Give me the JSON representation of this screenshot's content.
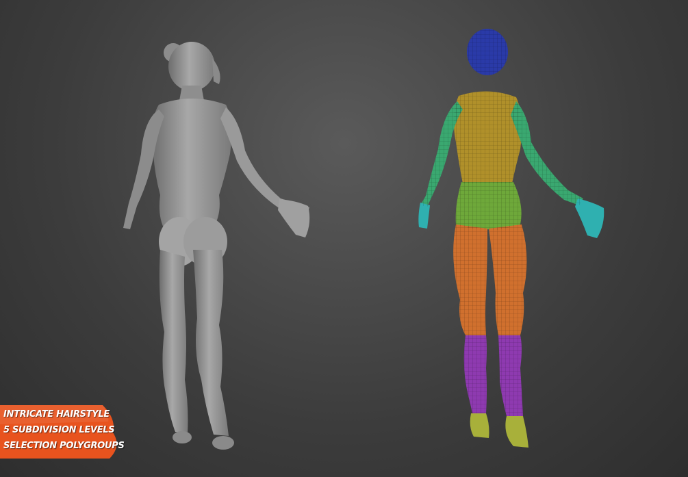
{
  "badge": {
    "lines": [
      "INTRICATE HAIRSTYLE",
      "5 SUBDIVISION LEVELS",
      "SELECTION POLYGROUPS"
    ],
    "color": "#e8531e"
  },
  "figures": {
    "left": {
      "style": "sculpt",
      "color": "#9a9a9a"
    },
    "right": {
      "style": "polygroups",
      "group_colors": {
        "head": "#2a3aa8",
        "torso": "#b0902a",
        "arms": "#3aa870",
        "hands": "#2fb0b0",
        "hips": "#6ea83a",
        "legs": "#d0702e",
        "shins": "#8e3ab0",
        "feet": "#a8b03a"
      }
    }
  }
}
